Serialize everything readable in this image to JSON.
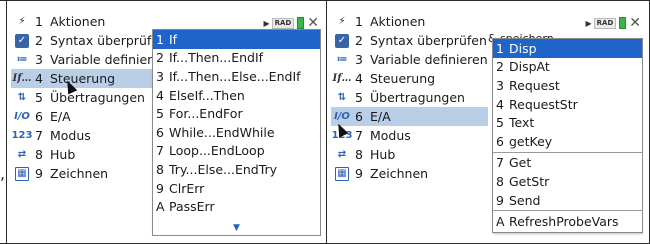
{
  "separator": ",",
  "status": {
    "mode": "RAD"
  },
  "left": {
    "main_menu": [
      {
        "num": "1",
        "label": "Aktionen",
        "icon": "lightning-icon"
      },
      {
        "num": "2",
        "label": "Syntax überprüfen",
        "icon": "check-icon"
      },
      {
        "num": "3",
        "label": "Variable definieren",
        "icon": "variable-icon"
      },
      {
        "num": "4",
        "label": "Steuerung",
        "icon": "control-icon"
      },
      {
        "num": "5",
        "label": "Übertragungen",
        "icon": "transfer-icon"
      },
      {
        "num": "6",
        "label": "E/A",
        "icon": "io-icon"
      },
      {
        "num": "7",
        "label": "Modus",
        "icon": "mode-icon"
      },
      {
        "num": "8",
        "label": "Hub",
        "icon": "hub-icon"
      },
      {
        "num": "9",
        "label": "Zeichnen",
        "icon": "draw-icon"
      }
    ],
    "submenu": [
      {
        "key": "1",
        "label": "If"
      },
      {
        "key": "2",
        "label": "If...Then...EndIf"
      },
      {
        "key": "3",
        "label": "If...Then...Else...EndIf"
      },
      {
        "key": "4",
        "label": "ElseIf...Then"
      },
      {
        "key": "5",
        "label": "For...EndFor"
      },
      {
        "key": "6",
        "label": "While...EndWhile"
      },
      {
        "key": "7",
        "label": "Loop...EndLoop"
      },
      {
        "key": "8",
        "label": "Try...Else...EndTry"
      },
      {
        "key": "9",
        "label": "ClrErr"
      },
      {
        "key": "A",
        "label": "PassErr"
      }
    ]
  },
  "right": {
    "main_menu": [
      {
        "num": "1",
        "label": "Aktionen",
        "icon": "lightning-icon"
      },
      {
        "num": "2",
        "label": "Syntax überprüfen",
        "icon": "check-icon"
      },
      {
        "num": "3",
        "label": "Variable definieren",
        "icon": "variable-icon"
      },
      {
        "num": "4",
        "label": "Steuerung",
        "icon": "control-icon"
      },
      {
        "num": "5",
        "label": "Übertragungen",
        "icon": "transfer-icon"
      },
      {
        "num": "6",
        "label": "E/A",
        "icon": "io-icon"
      },
      {
        "num": "7",
        "label": "Modus",
        "icon": "mode-icon"
      },
      {
        "num": "8",
        "label": "Hub",
        "icon": "hub-icon"
      },
      {
        "num": "9",
        "label": "Zeichnen",
        "icon": "draw-icon"
      }
    ],
    "overflow_line2": "& speichern",
    "submenu_group1": [
      {
        "key": "1",
        "label": "Disp"
      },
      {
        "key": "2",
        "label": "DispAt"
      },
      {
        "key": "3",
        "label": "Request"
      },
      {
        "key": "4",
        "label": "RequestStr"
      },
      {
        "key": "5",
        "label": "Text"
      },
      {
        "key": "6",
        "label": "getKey"
      }
    ],
    "submenu_group2": [
      {
        "key": "7",
        "label": "Get"
      },
      {
        "key": "8",
        "label": "GetStr"
      },
      {
        "key": "9",
        "label": "Send"
      }
    ],
    "submenu_group3": [
      {
        "key": "A",
        "label": "RefreshProbeVars"
      }
    ]
  }
}
